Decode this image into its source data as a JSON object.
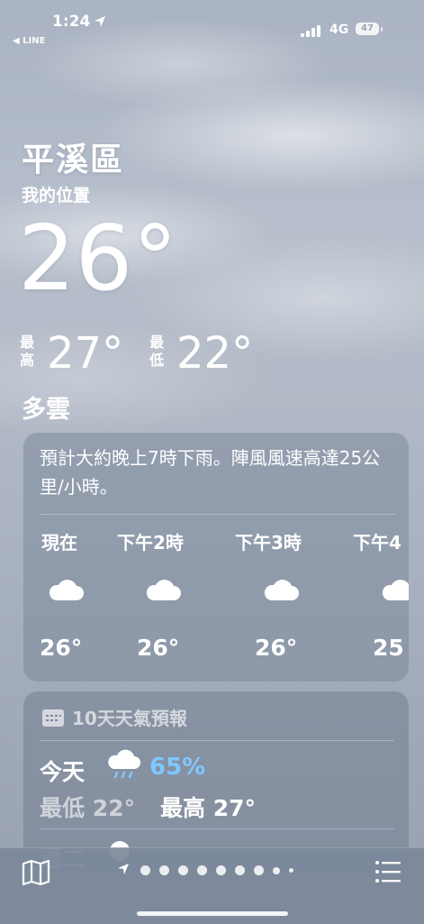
{
  "status_bar": {
    "time": "1:24",
    "back_app": "◀ LINE",
    "network": "4G",
    "battery": "47"
  },
  "header": {
    "city": "平溪區",
    "location_label": "我的位置",
    "current_temp": "26°",
    "high_label": "最高",
    "high_temp": "27°",
    "low_label": "最低",
    "low_temp": "22°",
    "condition": "多雲"
  },
  "hourly": {
    "summary": "預計大約晚上7時下雨。陣風風速高達25公里/小時。",
    "hours": [
      {
        "label": "現在",
        "icon": "cloud-icon",
        "temp": "26°"
      },
      {
        "label": "下午2時",
        "icon": "cloud-icon",
        "temp": "26°"
      },
      {
        "label": "下午3時",
        "icon": "cloud-icon",
        "temp": "26°"
      },
      {
        "label": "下午4",
        "icon": "cloud-icon",
        "temp": "25"
      }
    ]
  },
  "daily": {
    "title": "10天天氣預報",
    "icon": "calendar-icon",
    "today": {
      "day": "今天",
      "icon": "cloud-rain-icon",
      "precip": "65%",
      "low": "最低 22°",
      "high": "最高 27°"
    },
    "next_day": "週二"
  },
  "bottom_bar": {
    "left_icon": "map-icon",
    "right_icon": "list-icon"
  },
  "colors": {
    "precip": "#7fc8ff",
    "card_bg": "#7c889a"
  }
}
